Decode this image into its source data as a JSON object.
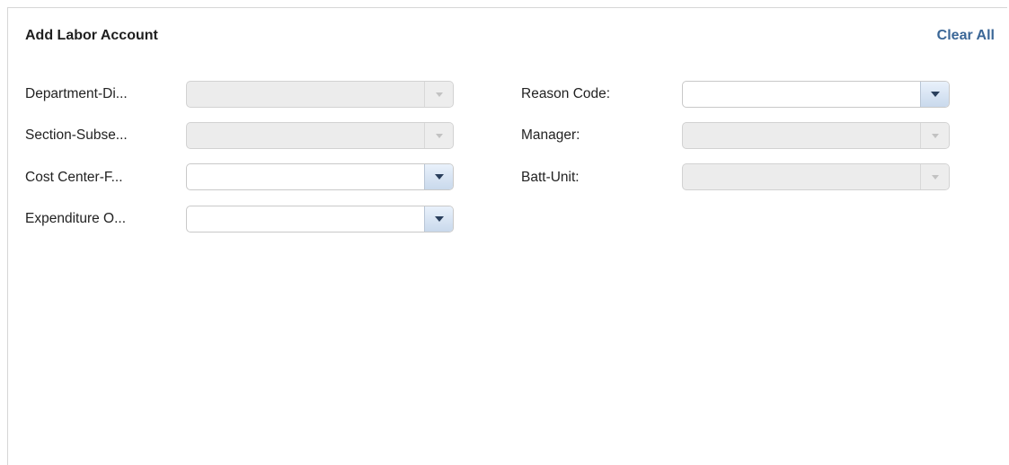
{
  "panel": {
    "title": "Add Labor Account",
    "clear_all_label": "Clear All"
  },
  "fields": {
    "department": {
      "label": "Department-Di...",
      "value": "",
      "enabled": false
    },
    "section": {
      "label": "Section-Subse...",
      "value": "",
      "enabled": false
    },
    "cost_center": {
      "label": "Cost Center-F...",
      "value": "",
      "enabled": true
    },
    "expenditure": {
      "label": "Expenditure O...",
      "value": "",
      "enabled": true
    },
    "reason_code": {
      "label": "Reason Code:",
      "value": "",
      "enabled": true
    },
    "manager": {
      "label": "Manager:",
      "value": "",
      "enabled": false
    },
    "batt_unit": {
      "label": "Batt-Unit:",
      "value": "",
      "enabled": false
    }
  },
  "icons": {
    "dropdown": "chevron-down-icon"
  },
  "colors": {
    "link": "#3b6797",
    "dropdown_button": "#c9d9ec",
    "disabled_field": "#ececec"
  }
}
